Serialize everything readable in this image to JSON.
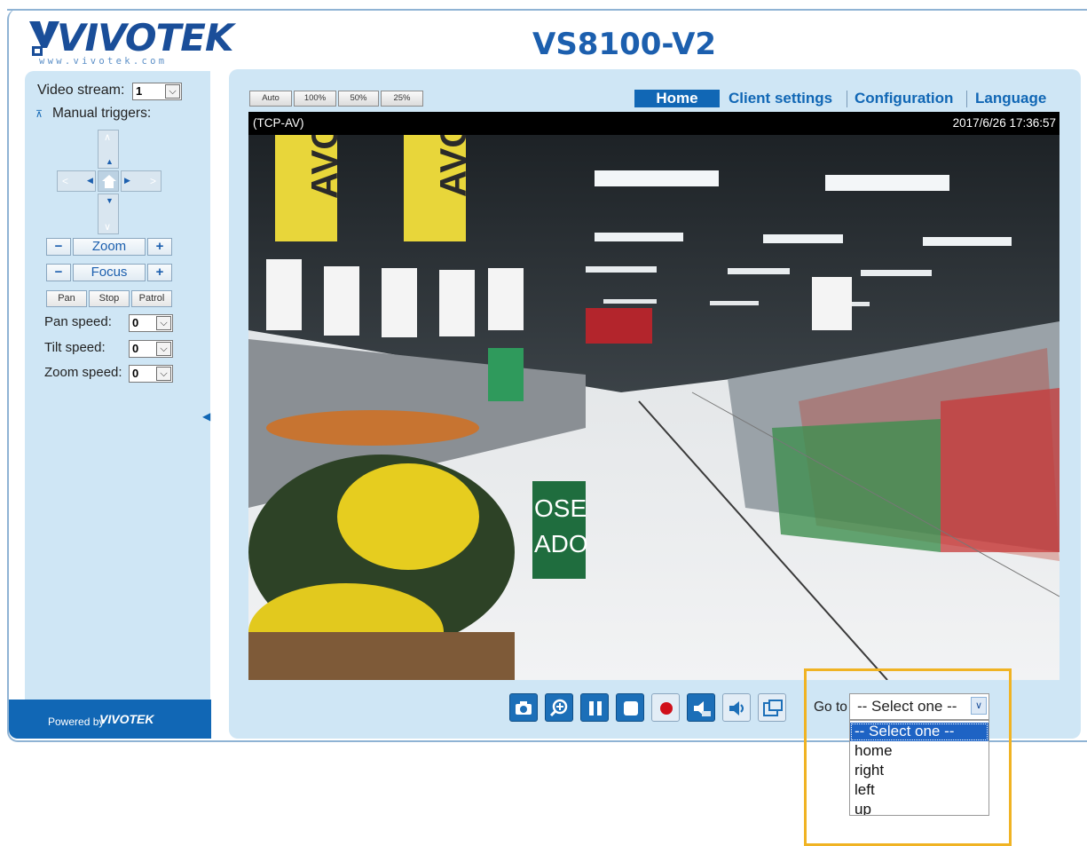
{
  "brand": {
    "logo": "VIVOTEK",
    "logo_url": "www.vivotek.com",
    "powered_by": "Powered by",
    "powered_logo": "VIVOTEK"
  },
  "page_title": "VS8100-V2",
  "left": {
    "video_stream_label": "Video stream:",
    "video_stream_value": "1",
    "manual_triggers": "Manual triggers:",
    "zoom": "Zoom",
    "focus": "Focus",
    "minus": "−",
    "plus": "+",
    "pan": "Pan",
    "stop": "Stop",
    "patrol": "Patrol",
    "pan_speed_label": "Pan speed:",
    "pan_speed_value": "0",
    "tilt_speed_label": "Tilt speed:",
    "tilt_speed_value": "0",
    "zoom_speed_label": "Zoom speed:",
    "zoom_speed_value": "0"
  },
  "view_buttons": [
    "Auto",
    "100%",
    "50%",
    "25%"
  ],
  "nav": {
    "home": "Home",
    "client_settings": "Client settings",
    "configuration": "Configuration",
    "language": "Language"
  },
  "video": {
    "protocol": "(TCP-AV)",
    "timestamp": "2017/6/26 17:36:57"
  },
  "controls": [
    "snapshot-icon",
    "digital-zoom-icon",
    "pause-icon",
    "stop-icon",
    "record-icon",
    "volume-down-icon",
    "speaker-icon",
    "fullscreen-icon"
  ],
  "goto": {
    "label": "Go to",
    "selected": "-- Select one --",
    "options": [
      "-- Select one --",
      "home",
      "right",
      "left",
      "up"
    ]
  },
  "colors": {
    "brand_blue": "#1167b5",
    "panel": "#cfe6f5",
    "highlight": "#f0b323"
  }
}
